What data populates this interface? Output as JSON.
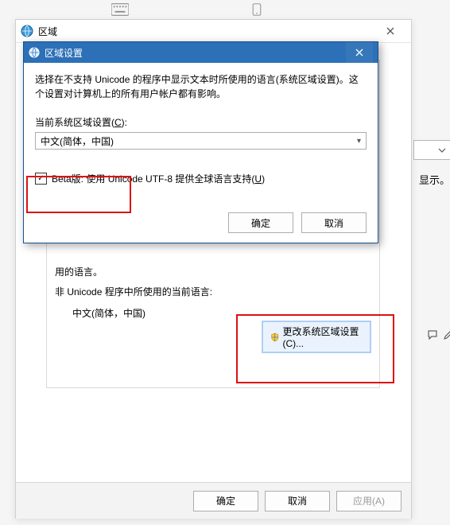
{
  "topIcons": {
    "keyboard": "keyboard-icon",
    "phone": "phone-icon"
  },
  "parentWindow": {
    "title": "区域",
    "fragmentText": "用的语言。",
    "nonUnicodeLabel": "非 Unicode 程序中所使用的当前语言:",
    "currentLang": "中文(简体，中国)",
    "changeLocaleBtn": "更改系统区域设置(C)...",
    "buttons": {
      "ok": "确定",
      "cancel": "取消",
      "apply": "应用(A)"
    }
  },
  "childDialog": {
    "title": "区域设置",
    "description": "选择在不支持 Unicode 的程序中显示文本时所使用的语言(系统区域设置)。这个设置对计算机上的所有用户帐户都有影响。",
    "comboLabelPrefix": "当前系统区域设置(",
    "comboLabelKey": "C",
    "comboLabelSuffix": "):",
    "comboValue": "中文(简体，中国)",
    "checkboxChecked": "✓",
    "checkboxTextPrefix": "Beta版: 使用 Unicode UTF-8 提供全球语言支持(",
    "checkboxKey": "U",
    "checkboxTextSuffix": ")",
    "buttons": {
      "ok": "确定",
      "cancel": "取消"
    }
  },
  "side": {
    "text": "显示。"
  }
}
